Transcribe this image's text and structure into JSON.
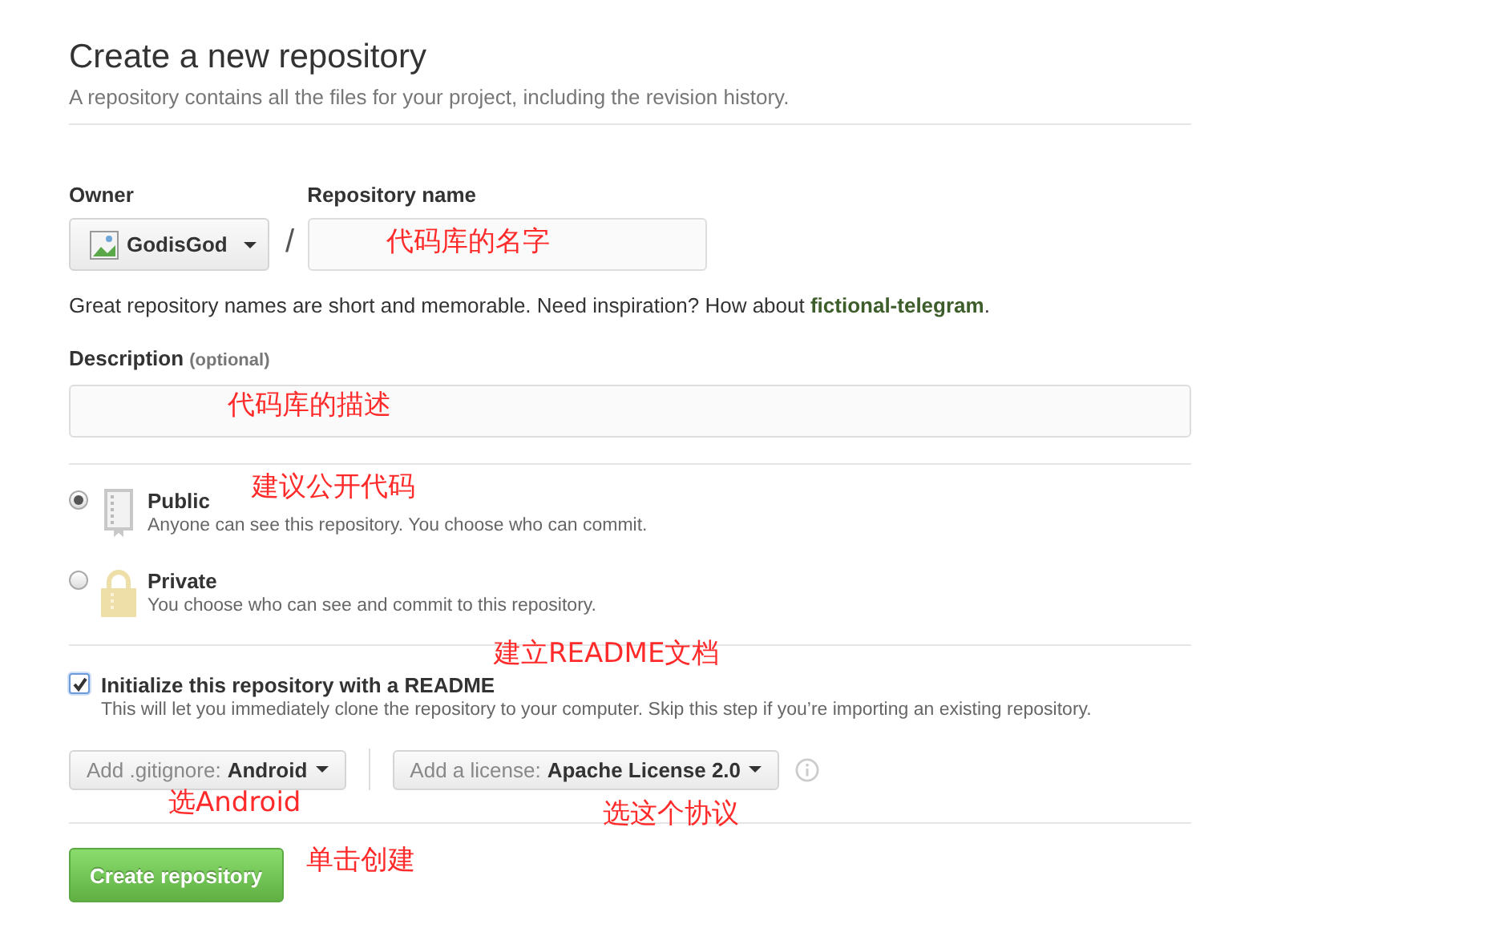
{
  "header": {
    "title": "Create a new repository",
    "subtitle": "A repository contains all the files for your project, including the revision history."
  },
  "owner": {
    "label": "Owner",
    "value": "GodisGod"
  },
  "separator": "/",
  "repository_name": {
    "label": "Repository name"
  },
  "hint": "Great repository names are short and memorable. Need inspiration? How about **fictional-telegram**.",
  "description": {
    "label": "Description",
    "note": "(optional)"
  },
  "visibility": [
    {
      "kind": "public",
      "label": "Public",
      "description": "Anyone can see this repository. You choose who can commit.",
      "selected": true
    },
    {
      "kind": "private",
      "label": "Private",
      "description": "You choose who can see and commit to this repository.",
      "selected": false
    }
  ],
  "readme": {
    "checked": true,
    "label": "Initialize this repository with a README",
    "description": "This will let you immediately clone the repository to your computer. Skip this step if you’re importing an existing repository."
  },
  "gitignore": {
    "prefix": "Add .gitignore:",
    "value": "Android"
  },
  "license": {
    "prefix": "Add a license:",
    "value": "Apache License 2.0"
  },
  "submit": "Create repository",
  "annotations": [
    {
      "text": "代码库的名字"
    },
    {
      "text": "代码库的描述"
    },
    {
      "text": "建议公开代码"
    },
    {
      "text": "建立README文档"
    },
    {
      "text": "选Android"
    },
    {
      "text": "选这个协议"
    },
    {
      "text": "单击创建"
    }
  ]
}
